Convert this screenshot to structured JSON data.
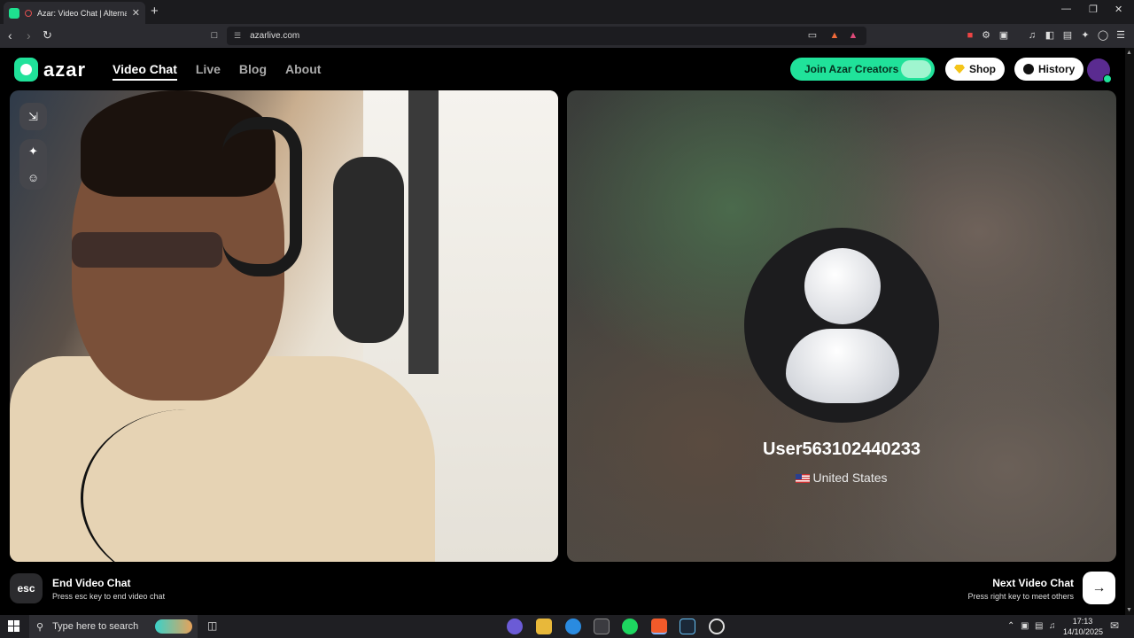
{
  "browser": {
    "tab_title": "Azar: Video Chat | Alternative",
    "tab_close": "✕",
    "new_tab": "+",
    "url": "azarlive.com",
    "window_controls": {
      "minimize": "—",
      "restore": "❐",
      "close": "✕"
    }
  },
  "site": {
    "logo_text": "azar",
    "nav": [
      {
        "label": "Video Chat",
        "active": true
      },
      {
        "label": "Live",
        "active": false
      },
      {
        "label": "Blog",
        "active": false
      },
      {
        "label": "About",
        "active": false
      }
    ],
    "creators_button": "Join Azar Creators",
    "shop_button": "Shop",
    "history_button": "History",
    "colors": {
      "accent": "#20e29a",
      "background": "#000000"
    }
  },
  "partner": {
    "username": "User563102440233",
    "country": "United States"
  },
  "controls": {
    "esc_key": "esc",
    "end_title": "End Video Chat",
    "end_sub": "Press esc key to end video chat",
    "next_title": "Next Video Chat",
    "next_sub": "Press right key to meet others",
    "next_arrow": "→"
  },
  "taskbar": {
    "search_placeholder": "Type here to search",
    "time": "17:13",
    "date": "14/10/2025"
  }
}
